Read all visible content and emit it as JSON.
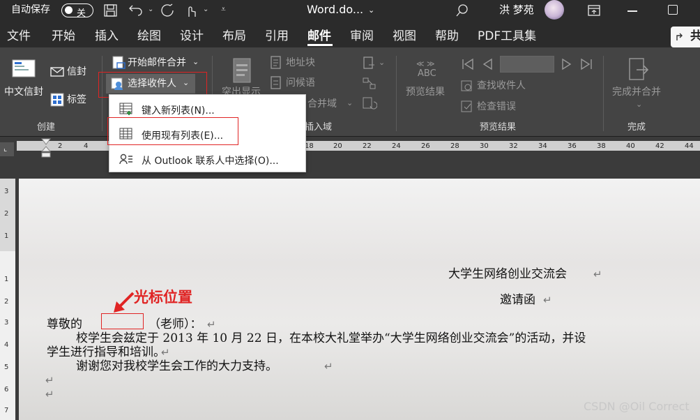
{
  "titlebar": {
    "autosave_label": "自动保存",
    "autosave_state": "关",
    "doc_title": "Word.do...",
    "user_name": "洪 梦苑"
  },
  "tabs": [
    "文件",
    "开始",
    "插入",
    "绘图",
    "设计",
    "布局",
    "引用",
    "邮件",
    "审阅",
    "视图",
    "帮助",
    "PDF工具集"
  ],
  "active_tab": "邮件",
  "share_label": "共",
  "ribbon": {
    "create": {
      "envelope_label": "中文信封",
      "envelope2_label": "信封",
      "labels_label": "标签",
      "group_label": "创建"
    },
    "start_merge": {
      "start_merge_label": "开始邮件合并",
      "select_recipients_label": "选择收件人",
      "highlight_label": "突出显示"
    },
    "insert_fields": {
      "address_block": "地址块",
      "greeting": "问候语",
      "insert_merge_field": "合并域",
      "group_label": "插入域"
    },
    "preview": {
      "preview_results": "预览结果",
      "abc_label": "ABC",
      "find_recipient": "查找收件人",
      "check_errors": "检查错误",
      "group_label": "预览结果"
    },
    "finish": {
      "finish_merge": "完成并合并",
      "group_label": "完成"
    }
  },
  "dropdown": {
    "items": [
      {
        "label": "键入新列表(N)..."
      },
      {
        "label": "使用现有列表(E)..."
      },
      {
        "label": "从 Outlook 联系人中选择(O)..."
      }
    ]
  },
  "ruler": {
    "ticks": [
      "2",
      "4",
      "18",
      "20",
      "22",
      "24",
      "26",
      "28",
      "30",
      "32",
      "34",
      "36",
      "38",
      "40",
      "42",
      "44"
    ],
    "vticks": [
      "3",
      "2",
      "1",
      "1",
      "2",
      "3",
      "4",
      "5",
      "6",
      "7"
    ]
  },
  "document": {
    "title1": "大学生网络创业交流会",
    "title2": "邀请函",
    "salutation_prefix": "尊敬的",
    "salutation_suffix": "（老师）：",
    "body1": "校学生会兹定于 2013 年 10 月 22 日，在本校大礼堂举办“大学生网络创业交流会”的活动，并设",
    "body2": "学生进行指导和培训。",
    "body3": "谢谢您对我校学生会工作的大力支持。",
    "para_mark": "↵"
  },
  "annotation": {
    "cursor_label": "光标位置"
  },
  "watermark": "CSDN @Oil Correct",
  "colors": {
    "annotation_red": "#e02424",
    "ribbon_bg": "#444444",
    "titlebar_bg": "#2b2b2b"
  }
}
